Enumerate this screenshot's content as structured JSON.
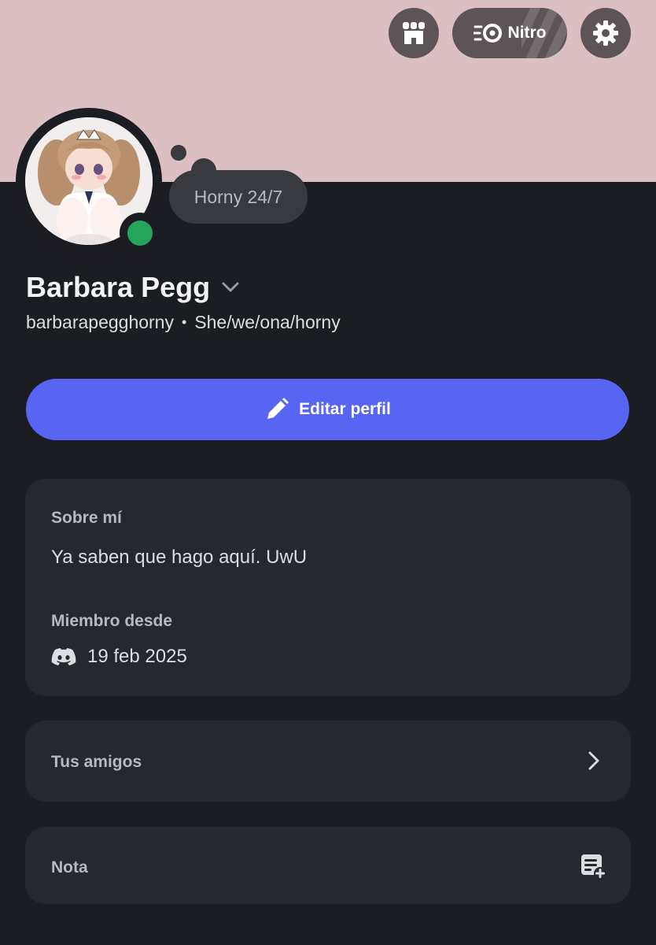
{
  "header": {
    "nitro_label": "Nitro",
    "banner_color": "#dcbfc3"
  },
  "profile": {
    "status_text": "Horny 24/7",
    "display_name": "Barbara Pegg",
    "username": "barbarapegghorny",
    "separator": "•",
    "pronouns": "She/we/ona/horny",
    "online_status_color": "#23a55a"
  },
  "actions": {
    "edit_profile_label": "Editar perfil",
    "accent_color": "#5865f2"
  },
  "about": {
    "title": "Sobre mí",
    "text": "Ya saben que hago aquí. UwU",
    "member_since_title": "Miembro desde",
    "member_since_date": "19 feb 2025"
  },
  "friends": {
    "title": "Tus amigos"
  },
  "note": {
    "title": "Nota"
  },
  "icons": {
    "shop": "shop-icon",
    "nitro": "nitro-icon",
    "settings": "gear-icon",
    "edit": "pencil-icon",
    "discord": "discord-icon",
    "chevron": "chevron-right-icon",
    "note": "note-add-icon"
  }
}
